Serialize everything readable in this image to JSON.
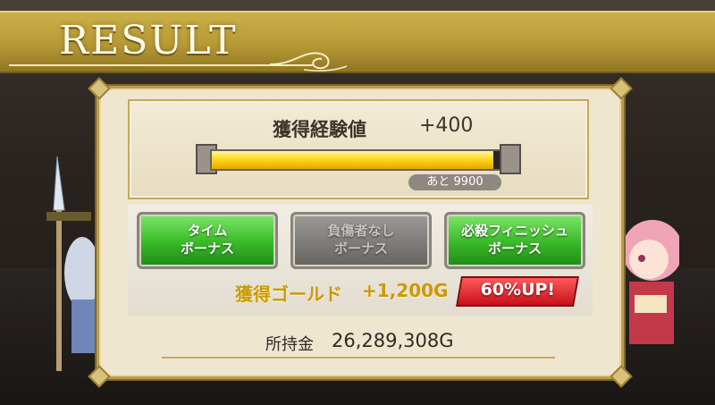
{
  "header": {
    "title": "RESULT"
  },
  "exp": {
    "label": "獲得経験値",
    "value": "+400",
    "progress": 0.95,
    "remaining": "あと 9900"
  },
  "bonuses": [
    {
      "label": "タイム\nボーナス",
      "active": true
    },
    {
      "label": "負傷者なし\nボーナス",
      "active": false
    },
    {
      "label": "必殺フィニッシュ\nボーナス",
      "active": true
    }
  ],
  "gold": {
    "label": "獲得ゴールド",
    "value": "+1,200G",
    "badge": "60%UP!"
  },
  "money": {
    "label": "所持金",
    "value": "26,289,308G"
  },
  "colors": {
    "banner": "#c2a540",
    "gold_text": "#c99a08",
    "bonus_on": "#38b826",
    "bonus_off": "#7e7c79",
    "badge_red": "#c8101a"
  },
  "icons": {
    "banner_ornament": "swirl-ornament-icon",
    "bar_cap": "arrow-cap-icon"
  }
}
